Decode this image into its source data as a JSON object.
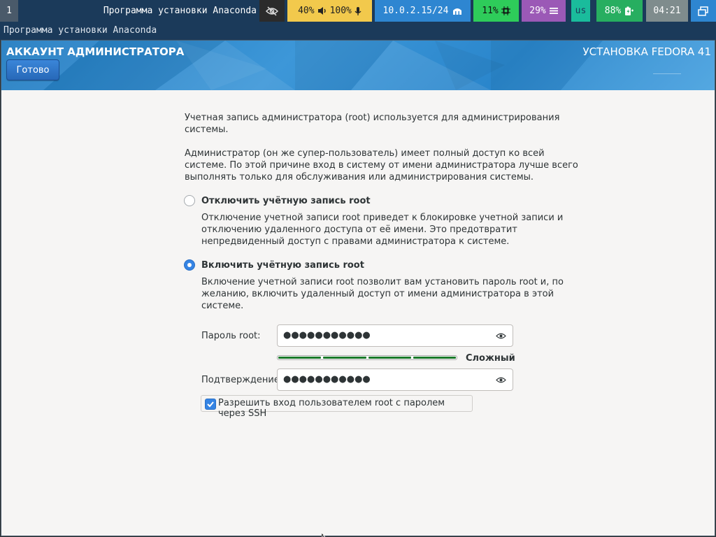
{
  "topbar": {
    "workspace": "1",
    "window_title": "Программа установки Anaconda",
    "volume": "40%",
    "mic": "100%",
    "network": "10.0.2.15/24",
    "cpu": "11%",
    "memory": "29%",
    "keyboard_layout": "us",
    "battery": "88%",
    "clock": "04:21"
  },
  "window": {
    "title": "Программа установки Anaconda"
  },
  "header": {
    "spoke_title": "АККАУНТ АДМИНИСТРАТОРА",
    "product": "УСТАНОВКА FEDORA 41",
    "done_label": "Готово"
  },
  "content": {
    "intro1_line1": "Учетная запись администратора (root) используется для администрирования",
    "intro1_line2": "системы.",
    "intro2_line1": "Администратор (он же супер-пользователь) имеет полный доступ ко всей",
    "intro2_line2": "системе. По этой причине вход в систему от имени администратора лучше всего",
    "intro2_line3": "выполнять только для обслуживания или администрирования системы.",
    "disable_label": "Отключить учётную запись root",
    "disable_desc_line1": "Отключение учетной записи root приведет к блокировке учетной записи и",
    "disable_desc_line2": "отключению удаленного доступа от её имени. Это предотвратит",
    "disable_desc_line3": "непредвиденный доступ с правами администратора к системе.",
    "enable_label": "Включить учётную запись root",
    "enable_desc_line1": "Включение учетной записи root позволит вам установить пароль root и, по",
    "enable_desc_line2": "желанию, включить удаленный доступ от имени администратора в этой",
    "enable_desc_line3": "системе.",
    "password_label": "Пароль root:",
    "password_value": "●●●●●●●●●●●",
    "strength_label": "Сложный",
    "strength_level": 1.0,
    "confirm_label": "Подтверждение:",
    "confirm_value": "●●●●●●●●●●●",
    "ssh_label": "Разрешить вход пользователем root с паролем через SSH",
    "selected_option": "enable",
    "ssh_checked": true
  },
  "colors": {
    "accent": "#3584e4",
    "strength_fill": "#1a7a2a",
    "volume_block": "#f2c94c",
    "network_block": "#2e86d1",
    "cpu_block": "#2ecc5a",
    "memory_block": "#9b59b6",
    "keyboard_block": "#1abc9c",
    "battery_block": "#27ae60",
    "clock_block": "#7f8c8d"
  }
}
